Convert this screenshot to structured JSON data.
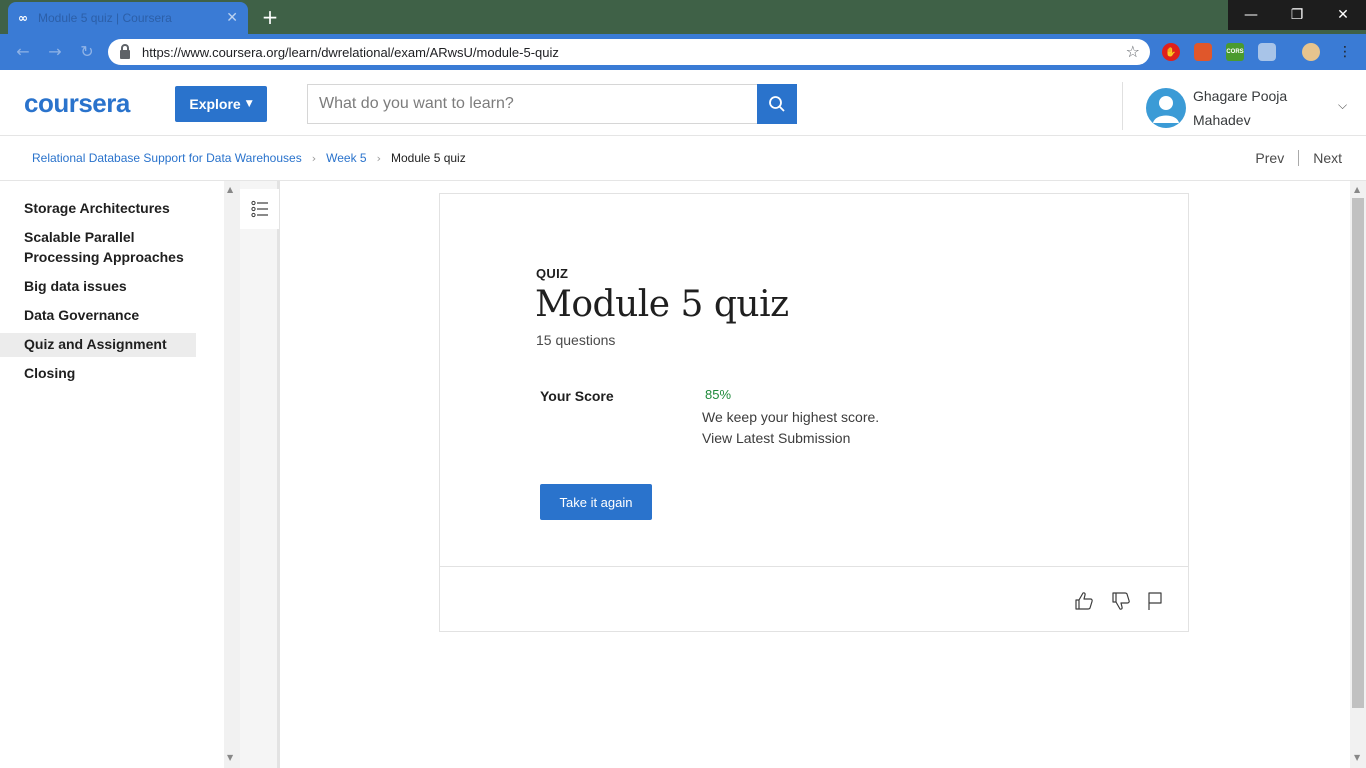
{
  "browser": {
    "tab_title": "Module 5 quiz | Coursera",
    "tab_icon": "infinity-icon",
    "url": "https://www.coursera.org/learn/dwrelational/exam/ARwsU/module-5-quiz",
    "window_controls": {
      "minimize": "—",
      "restore": "❐",
      "close": "✕"
    },
    "new_tab": "+",
    "extensions": [
      "stop-icon",
      "brave-shield-icon",
      "cors-icon",
      "shield-icon",
      "profile-avatar-icon"
    ],
    "ext_cors_label": "CORS"
  },
  "header": {
    "logo": "coursera",
    "explore_label": "Explore",
    "search_placeholder": "What do you want to learn?",
    "user_name": "Ghagare Pooja Mahadev"
  },
  "breadcrumb": {
    "course": "Relational Database Support for Data Warehouses",
    "week": "Week 5",
    "current": "Module 5 quiz",
    "prev_label": "Prev",
    "next_label": "Next"
  },
  "sidebar": {
    "items": [
      {
        "label": "Storage Architectures",
        "active": false
      },
      {
        "label": "Scalable Parallel Processing Approaches",
        "active": false
      },
      {
        "label": "Big data issues",
        "active": false
      },
      {
        "label": "Data Governance",
        "active": false
      },
      {
        "label": "Quiz and Assignment",
        "active": true
      },
      {
        "label": "Closing",
        "active": false
      }
    ]
  },
  "quiz": {
    "type_label": "QUIZ",
    "title": "Module 5 quiz",
    "question_count": "15 questions",
    "score_label": "Your Score",
    "score_value": "85%",
    "keep_note": "We keep your highest score.",
    "view_latest": "View Latest Submission",
    "retake_label": "Take it again"
  },
  "colors": {
    "brand": "#2a73cc",
    "score_green": "#1f8a3b",
    "tabstrip": "#3f6147"
  }
}
